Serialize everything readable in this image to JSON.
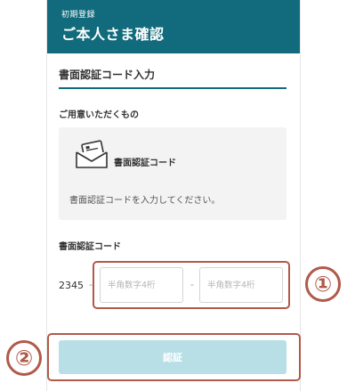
{
  "header": {
    "subtitle": "初期登録",
    "title": "ご本人さま確認"
  },
  "section": {
    "title": "書面認証コード入力",
    "prep_label": "ご用意いただくもの"
  },
  "card": {
    "icon": "document-envelope-icon",
    "label": "書面認証コード",
    "description": "書面認証コードを入力してください。"
  },
  "code": {
    "label": "書面認証コード",
    "prefix": "2345",
    "prefix_separator": "-",
    "middle_separator": "-",
    "input1": {
      "value": "",
      "placeholder": "半角数字4桁"
    },
    "input2": {
      "value": "",
      "placeholder": "半角数字4桁"
    }
  },
  "annotations": {
    "badge1": "①",
    "badge2": "②",
    "color": "#b05a4a"
  },
  "submit": {
    "label": "認証",
    "enabled": false
  },
  "colors": {
    "header_bg": "#126b7c",
    "button_disabled_bg": "#b8dfe6",
    "card_bg": "#f3f3f3"
  }
}
